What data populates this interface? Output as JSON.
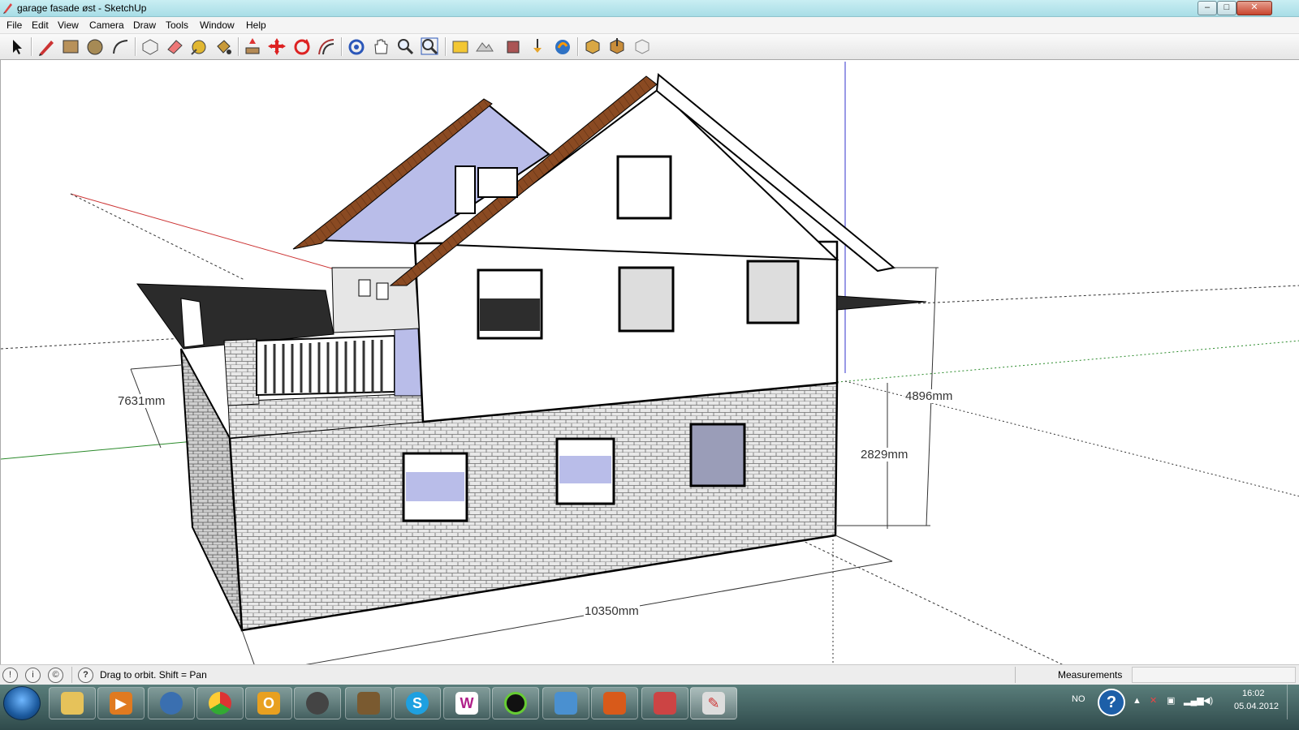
{
  "window": {
    "title": "garage fasade øst - SketchUp",
    "minimize": "–",
    "maximize": "□",
    "close": "✕"
  },
  "menu": [
    "File",
    "Edit",
    "View",
    "Camera",
    "Draw",
    "Tools",
    "Window",
    "Help"
  ],
  "toolbar_icons": [
    "select-icon",
    "pencil-icon",
    "rectangle-icon",
    "circle-icon",
    "arc-icon",
    "make-component-icon",
    "eraser-icon",
    "tape-measure-icon",
    "paint-bucket-icon",
    "push-pull-icon",
    "move-icon",
    "rotate-icon",
    "offset-icon",
    "orbit-icon",
    "pan-icon",
    "zoom-icon",
    "zoom-extents-icon",
    "add-location-icon",
    "toggle-terrain-icon",
    "preview-google-earth-icon",
    "get-models-icon",
    "share-model-icon",
    "share-component-icon",
    "extension-warehouse-icon",
    "get-components-icon",
    "layout-icon"
  ],
  "dimensions": {
    "width": "10350mm",
    "depth": "7631mm",
    "height_total": "4896mm",
    "height_lower": "2829mm"
  },
  "status": {
    "message": "Drag to orbit.  Shift = Pan",
    "measurements_label": "Measurements",
    "measurements_value": "",
    "help_icon": "?"
  },
  "taskbar": {
    "apps": [
      "file-explorer-icon",
      "media-player-icon",
      "wifi-icon",
      "chrome-icon",
      "outlook-icon",
      "mail-icon",
      "game-icon",
      "skype-icon",
      "word-icon",
      "green-ring-icon",
      "people-icon",
      "office-icon",
      "sketchup-layout-icon",
      "sketchup-icon"
    ],
    "language": "NO",
    "time": "16:02",
    "date": "05.04.2012"
  },
  "colors": {
    "accent_title": "#b5e6ee",
    "taskbar": "#3f5f5f",
    "roof_wood": "#8a4a22",
    "roof_glass": "#b9bde9",
    "stone": "#e4e4e4"
  }
}
